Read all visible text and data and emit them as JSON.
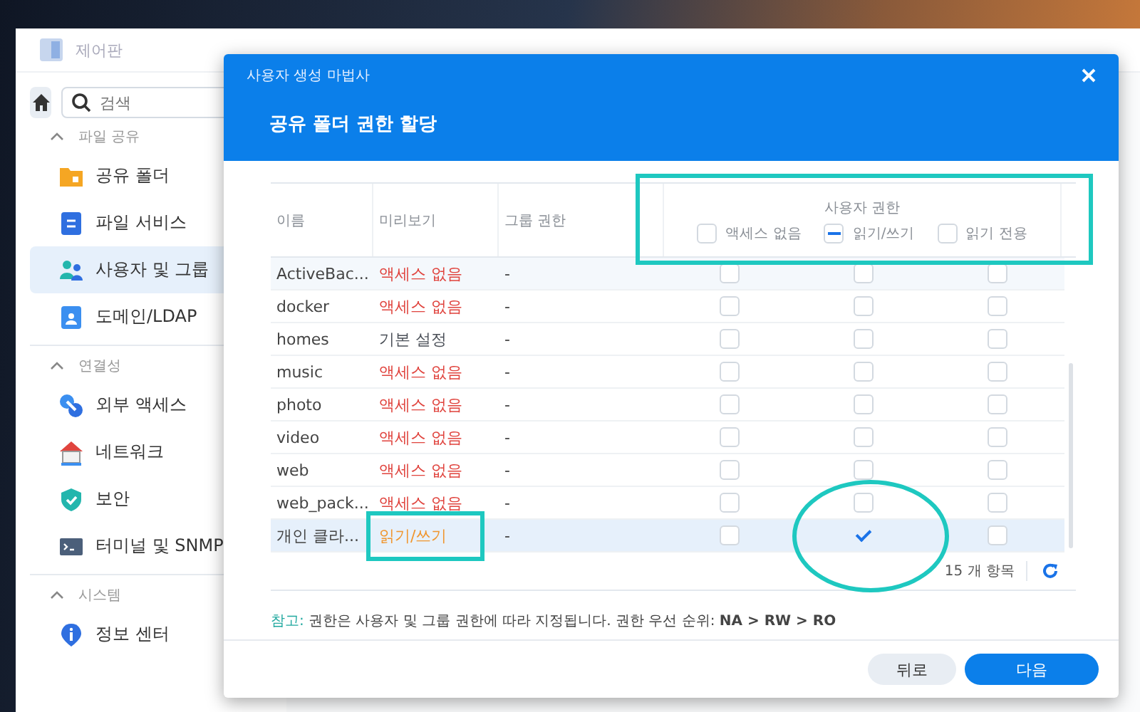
{
  "app_window": {
    "title": "제어판",
    "search": {
      "placeholder": "검색"
    },
    "sidebar": [
      {
        "title": "파일 공유",
        "expanded": true,
        "items": [
          {
            "label": "공유 폴더",
            "selected": false
          },
          {
            "label": "파일 서비스",
            "selected": false
          },
          {
            "label": "사용자 및 그룹",
            "selected": true
          },
          {
            "label": "도메인/LDAP",
            "selected": false
          }
        ]
      },
      {
        "title": "연결성",
        "expanded": true,
        "items": [
          {
            "label": "외부 액세스",
            "selected": false
          },
          {
            "label": "네트워크",
            "selected": false
          },
          {
            "label": "보안",
            "selected": false
          },
          {
            "label": "터미널 및 SNMP",
            "selected": false
          }
        ]
      },
      {
        "title": "시스템",
        "expanded": true,
        "items": [
          {
            "label": "정보 센터",
            "selected": false
          }
        ]
      }
    ]
  },
  "dialog": {
    "title": "사용자 생성 마법사",
    "heading": "공유 폴더 권한 할당",
    "columns": [
      "이름",
      "미리보기",
      "그룹 권한"
    ],
    "user_permissions": {
      "title": "사용자 권한",
      "options": [
        {
          "label": "액세스 없음",
          "checked": false,
          "indeterminate": false
        },
        {
          "label": "읽기/쓰기",
          "checked": false,
          "indeterminate": true
        },
        {
          "label": "읽기 전용",
          "checked": false,
          "indeterminate": false
        }
      ]
    },
    "rows": [
      {
        "name": "ActiveBac...",
        "preview": "액세스 없음",
        "color": "#e0443e",
        "group": "-",
        "no_access": false,
        "read_write": false,
        "read_only": false,
        "selected": false
      },
      {
        "name": "docker",
        "preview": "액세스 없음",
        "color": "#e0443e",
        "group": "-",
        "no_access": false,
        "read_write": false,
        "read_only": false,
        "selected": false
      },
      {
        "name": "homes",
        "preview": "기본 설정",
        "color": "#4a4f57",
        "group": "-",
        "no_access": false,
        "read_write": false,
        "read_only": false,
        "selected": false
      },
      {
        "name": "music",
        "preview": "액세스 없음",
        "color": "#e0443e",
        "group": "-",
        "no_access": false,
        "read_write": false,
        "read_only": false,
        "selected": false
      },
      {
        "name": "photo",
        "preview": "액세스 없음",
        "color": "#e0443e",
        "group": "-",
        "no_access": false,
        "read_write": false,
        "read_only": false,
        "selected": false
      },
      {
        "name": "video",
        "preview": "액세스 없음",
        "color": "#e0443e",
        "group": "-",
        "no_access": false,
        "read_write": false,
        "read_only": false,
        "selected": false
      },
      {
        "name": "web",
        "preview": "액세스 없음",
        "color": "#e0443e",
        "group": "-",
        "no_access": false,
        "read_write": false,
        "read_only": false,
        "selected": false
      },
      {
        "name": "web_pack...",
        "preview": "액세스 없음",
        "color": "#e0443e",
        "group": "-",
        "no_access": false,
        "read_write": false,
        "read_only": false,
        "selected": false
      },
      {
        "name": "개인 클라...",
        "preview": "읽기/쓰기",
        "color": "#f0962e",
        "group": "-",
        "no_access": false,
        "read_write": true,
        "read_only": false,
        "selected": true
      }
    ],
    "item_count": "15 개 항목",
    "note": "참고: 권한은 사용자 및 그룹 권한에 따라 지정됩니다. 권한 우선 순위: **NA > RW > RO**",
    "buttons": [
      {
        "label": "뒤로",
        "kind": "secondary"
      },
      {
        "label": "다음",
        "kind": "primary"
      }
    ]
  }
}
